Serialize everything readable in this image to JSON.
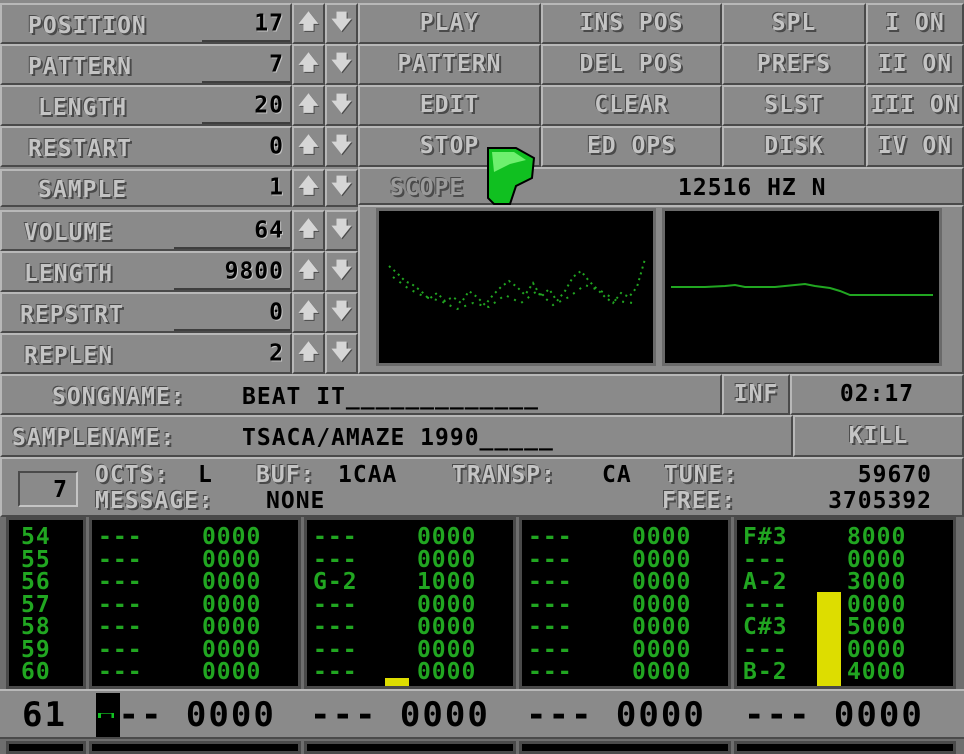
{
  "song": {
    "position": {
      "label": "POSITION",
      "value": "17"
    },
    "pattern": {
      "label": "PATTERN",
      "value": "7"
    },
    "length": {
      "label": "LENGTH",
      "value": "20"
    },
    "restart": {
      "label": "RESTART",
      "value": "0"
    }
  },
  "buttons": {
    "play": "PLAY",
    "pattern": "PATTERN",
    "edit": "EDIT",
    "stop": "STOP",
    "ins_pos": "INS POS",
    "del_pos": "DEL POS",
    "clear": "CLEAR",
    "ed_ops": "ED OPS",
    "spl": "SPL",
    "prefs": "PREFS",
    "slst": "SLST",
    "disk": "DISK",
    "ch1": "I ON",
    "ch2": "II ON",
    "ch3": "III ON",
    "ch4": "IV ON",
    "inf": "INF",
    "kill": "KILL"
  },
  "sample": {
    "number": {
      "label": "SAMPLE",
      "value": "1"
    },
    "volume": {
      "label": "VOLUME",
      "value": "64"
    },
    "length": {
      "label": "LENGTH",
      "value": "9800"
    },
    "repstrt": {
      "label": "REPSTRT",
      "value": "0"
    },
    "replen": {
      "label": "REPLEN",
      "value": "2"
    }
  },
  "scope": {
    "label": "SCOPE",
    "freq": "12516 HZ N"
  },
  "songname": {
    "label": "SONGNAME:",
    "value": "BEAT IT_____________"
  },
  "time": "02:17",
  "samplename": {
    "label": "SAMPLENAME:",
    "value": "TSACA/AMAZE 1990_____"
  },
  "info": {
    "pattern_box": "7",
    "octs_label": "OCTS:",
    "octs_value": "L",
    "buf_label": "BUF:",
    "buf_value": "1CAA",
    "transp_label": "TRANSP:",
    "transp_value": "CA",
    "tune_label": "TUNE:",
    "tune_value": "59670",
    "message_label": "MESSAGE:",
    "message_value": "NONE",
    "free_label": "FREE:",
    "free_value": "3705392"
  },
  "tracker": {
    "row_numbers": [
      "54",
      "55",
      "56",
      "57",
      "58",
      "59",
      "60"
    ],
    "tracks": [
      {
        "notes": [
          "---",
          "---",
          "---",
          "---",
          "---",
          "---",
          "---"
        ],
        "cmds": [
          "0000",
          "0000",
          "0000",
          "0000",
          "0000",
          "0000",
          "0000"
        ]
      },
      {
        "notes": [
          "---",
          "---",
          "G-2",
          "---",
          "---",
          "---",
          "---"
        ],
        "cmds": [
          "0000",
          "0000",
          "1000",
          "0000",
          "0000",
          "0000",
          "0000"
        ]
      },
      {
        "notes": [
          "---",
          "---",
          "---",
          "---",
          "---",
          "---",
          "---"
        ],
        "cmds": [
          "0000",
          "0000",
          "0000",
          "0000",
          "0000",
          "0000",
          "0000"
        ]
      },
      {
        "notes": [
          "F#3",
          "---",
          "A-2",
          "---",
          "C#3",
          "---",
          "B-2"
        ],
        "cmds": [
          "8000",
          "0000",
          "3000",
          "0000",
          "5000",
          "0000",
          "4000"
        ]
      }
    ],
    "current_row": "61",
    "current_cells": [
      {
        "note": "---",
        "cmd": "0000"
      },
      {
        "note": "---",
        "cmd": "0000"
      },
      {
        "note": "---",
        "cmd": "0000"
      },
      {
        "note": "---",
        "cmd": "0000"
      }
    ],
    "vu_levels": [
      0,
      0.08,
      0,
      0.43
    ]
  },
  "colors": {
    "panel": "#8a8a8a",
    "pattern_text": "#21a621",
    "vu_meter": "#dddd00",
    "pointer": "#10c020"
  }
}
